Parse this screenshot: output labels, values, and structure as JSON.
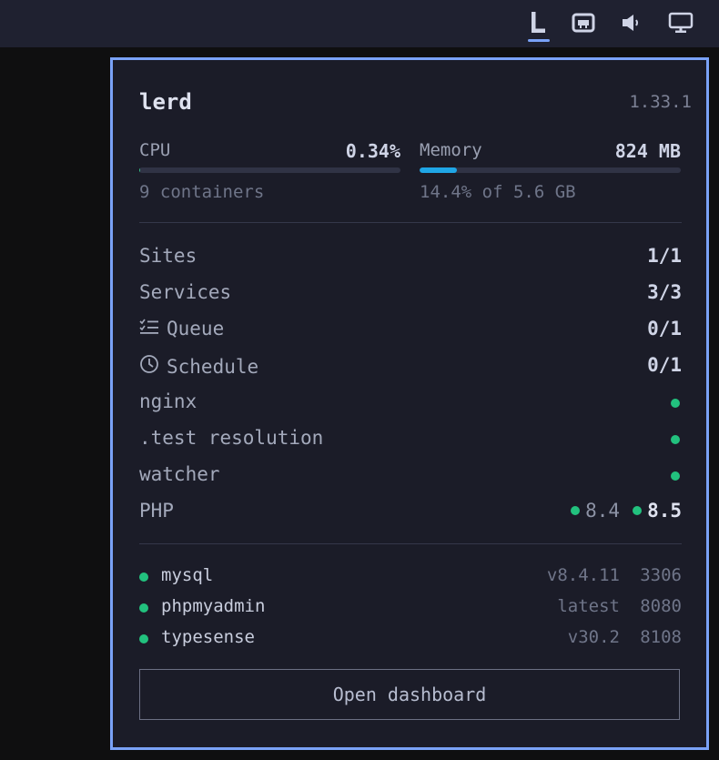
{
  "tray": {
    "items": [
      {
        "icon": "lerd-logo-icon",
        "glyph": "L",
        "active": true
      },
      {
        "icon": "network-icon"
      },
      {
        "icon": "volume-icon"
      },
      {
        "icon": "display-icon"
      }
    ],
    "accent": "#7aa2f7"
  },
  "panel": {
    "title": "lerd",
    "version": "1.33.1",
    "cpu": {
      "label": "CPU",
      "value": "0.34%",
      "percent": 0.34,
      "sub": "9 containers"
    },
    "memory": {
      "label": "Memory",
      "value": "824 MB",
      "percent": 14.4,
      "sub": "14.4% of 5.6 GB"
    },
    "stats": [
      {
        "label": "Sites",
        "value": "1/1"
      },
      {
        "label": "Services",
        "value": "3/3"
      },
      {
        "label": "Queue",
        "value": "0/1",
        "icon": "checklist-icon"
      },
      {
        "label": "Schedule",
        "value": "0/1",
        "icon": "clock-icon"
      }
    ],
    "status": [
      {
        "label": "nginx",
        "state": "running"
      },
      {
        "label": ".test resolution",
        "state": "running"
      },
      {
        "label": "watcher",
        "state": "running"
      }
    ],
    "php": {
      "label": "PHP",
      "versions": [
        "8.4",
        "8.5"
      ]
    },
    "services": [
      {
        "name": "mysql",
        "version": "v8.4.11",
        "port": "3306"
      },
      {
        "name": "phpmyadmin",
        "version": "latest",
        "port": "8080"
      },
      {
        "name": "typesense",
        "version": "v30.2",
        "port": "8108"
      }
    ],
    "dashboard_button": "Open dashboard",
    "colors": {
      "running": "#22c17e",
      "memory_bar": "#1fa6e6",
      "border": "#7aa2f7"
    }
  }
}
